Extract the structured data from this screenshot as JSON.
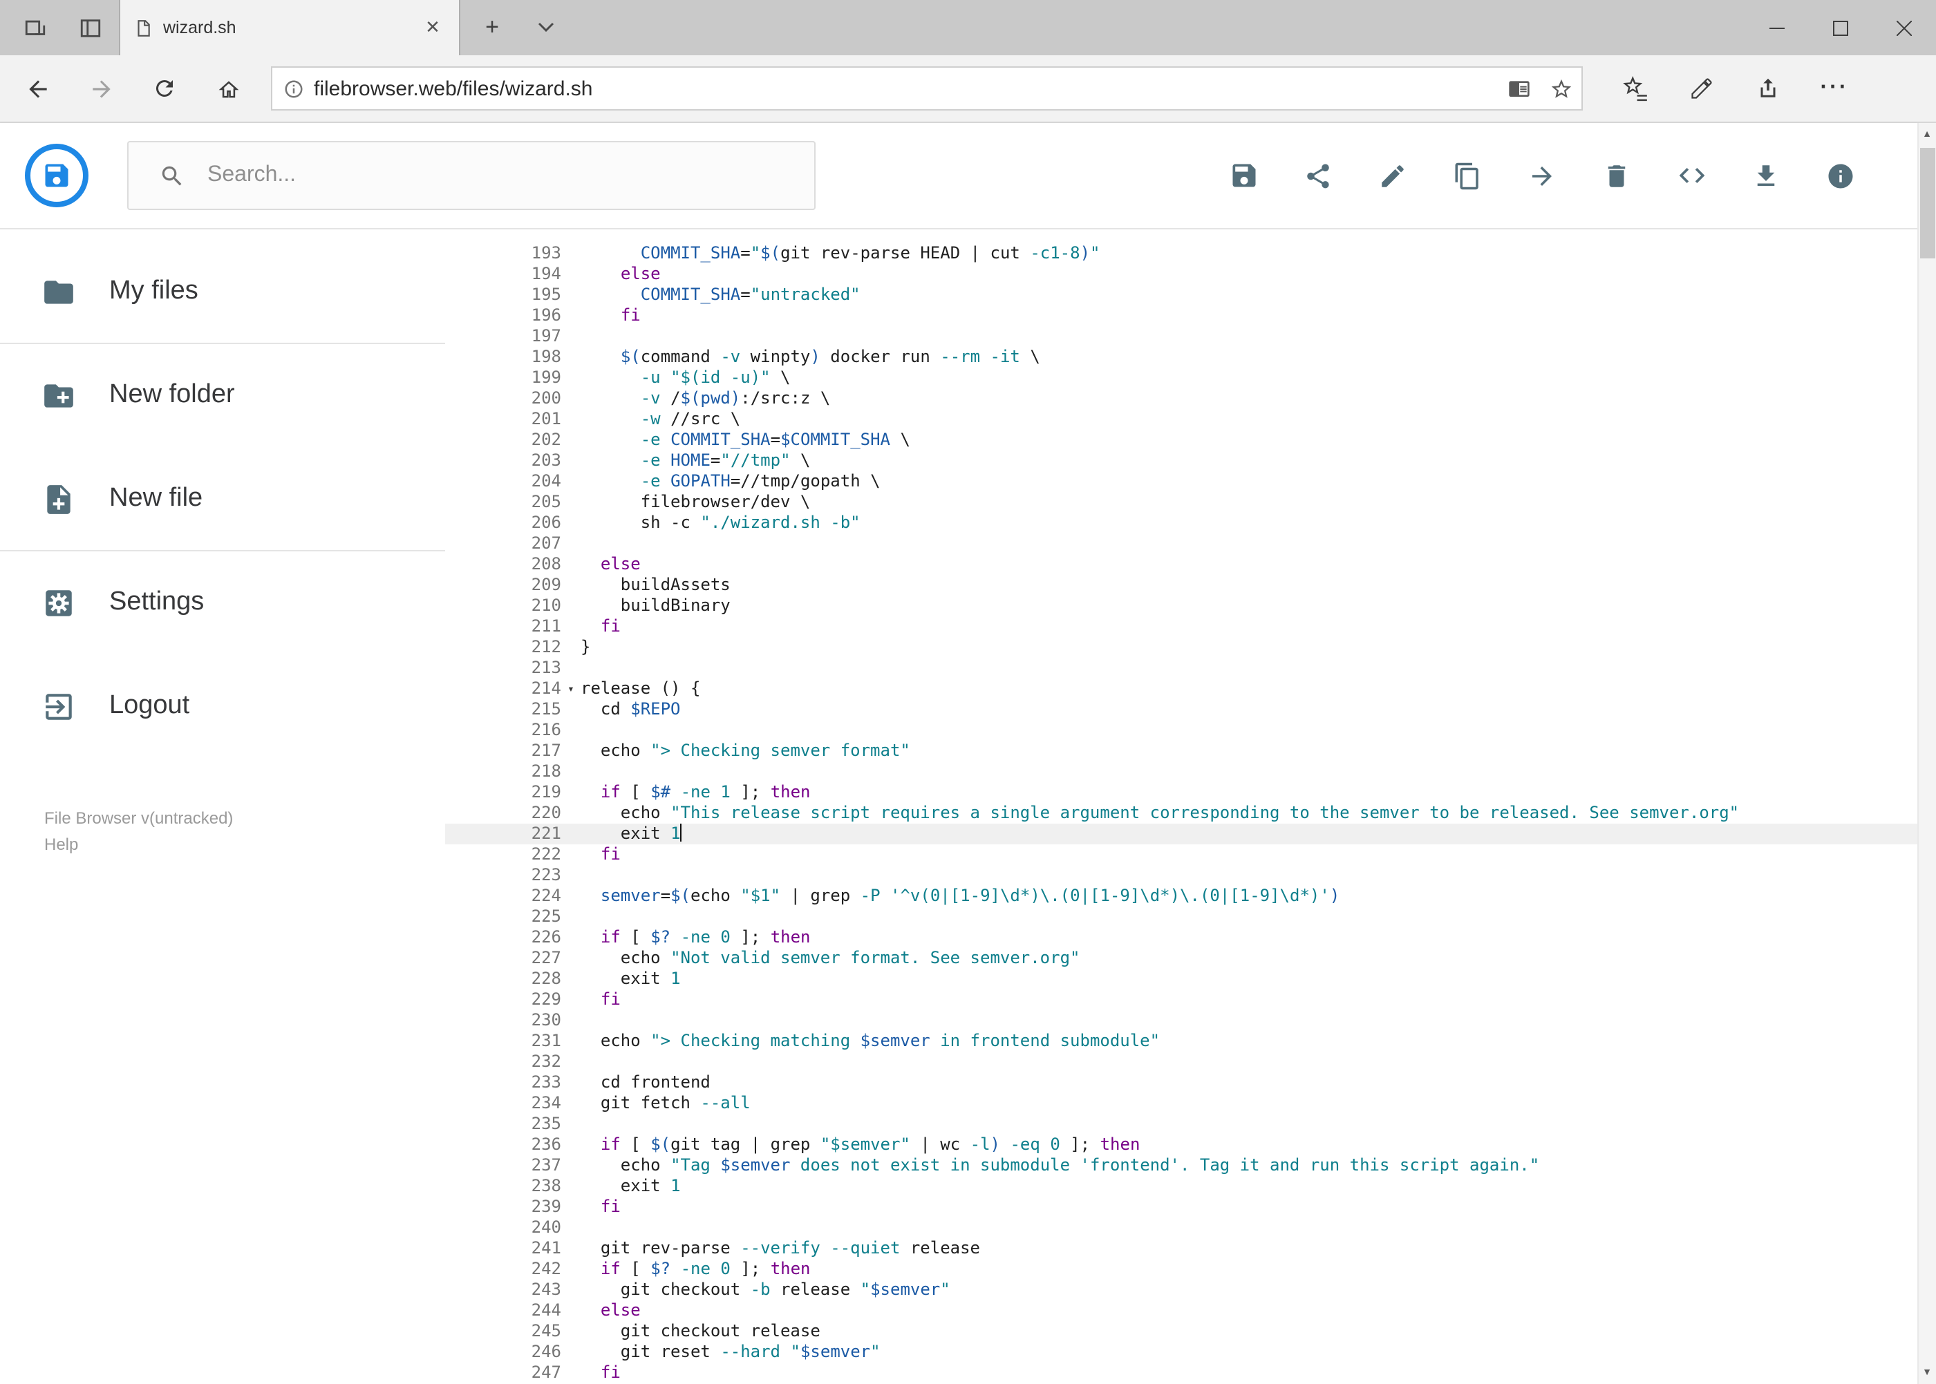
{
  "browser": {
    "tab_title": "wizard.sh",
    "url": "filebrowser.web/files/wizard.sh"
  },
  "header": {
    "search_placeholder": "Search...",
    "actions": [
      "save",
      "share",
      "edit",
      "copy",
      "move",
      "delete",
      "code",
      "download",
      "info"
    ]
  },
  "sidebar": {
    "items": [
      {
        "label": "My files",
        "icon": "folder"
      },
      {
        "label": "New folder",
        "icon": "create-new-folder"
      },
      {
        "label": "New file",
        "icon": "note-add"
      },
      {
        "label": "Settings",
        "icon": "settings"
      },
      {
        "label": "Logout",
        "icon": "logout"
      }
    ],
    "footer": {
      "version": "File Browser v(untracked)",
      "help": "Help"
    }
  },
  "colors": {
    "logo_blue": "#1e88e5",
    "header_icon": "#546e7a",
    "editor": {
      "plain": "#1f1f1f",
      "keyword": "#770088",
      "string": "#0e7f8c",
      "variable": "#1b5aa5"
    }
  },
  "editor": {
    "active_line": 221,
    "fold_lines": [
      214
    ],
    "lines": [
      {
        "n": 193,
        "t": [
          [
            "p",
            "      "
          ],
          [
            "v",
            "COMMIT_SHA"
          ],
          [
            "p",
            "="
          ],
          [
            "s",
            "\""
          ],
          [
            "v",
            "$("
          ],
          [
            "p",
            "git rev-parse HEAD | cut "
          ],
          [
            "s",
            "-c1-8"
          ],
          [
            "v",
            ")"
          ],
          [
            "s",
            "\""
          ]
        ]
      },
      {
        "n": 194,
        "t": [
          [
            "p",
            "    "
          ],
          [
            "k",
            "else"
          ]
        ]
      },
      {
        "n": 195,
        "t": [
          [
            "p",
            "      "
          ],
          [
            "v",
            "COMMIT_SHA"
          ],
          [
            "p",
            "="
          ],
          [
            "s",
            "\"untracked\""
          ]
        ]
      },
      {
        "n": 196,
        "t": [
          [
            "p",
            "    "
          ],
          [
            "k",
            "fi"
          ]
        ]
      },
      {
        "n": 197,
        "t": []
      },
      {
        "n": 198,
        "t": [
          [
            "p",
            "    "
          ],
          [
            "v",
            "$("
          ],
          [
            "p",
            "command "
          ],
          [
            "s",
            "-v"
          ],
          [
            "p",
            " winpty"
          ],
          [
            "v",
            ")"
          ],
          [
            "p",
            " docker run "
          ],
          [
            "s",
            "--rm"
          ],
          [
            "p",
            " "
          ],
          [
            "s",
            "-it"
          ],
          [
            "p",
            " \\"
          ]
        ]
      },
      {
        "n": 199,
        "t": [
          [
            "p",
            "      "
          ],
          [
            "s",
            "-u"
          ],
          [
            "p",
            " "
          ],
          [
            "s",
            "\"$(id -u)\""
          ],
          [
            "p",
            " \\"
          ]
        ]
      },
      {
        "n": 200,
        "t": [
          [
            "p",
            "      "
          ],
          [
            "s",
            "-v"
          ],
          [
            "p",
            " /"
          ],
          [
            "v",
            "$(pwd)"
          ],
          [
            "p",
            ":/src:z \\"
          ]
        ]
      },
      {
        "n": 201,
        "t": [
          [
            "p",
            "      "
          ],
          [
            "s",
            "-w"
          ],
          [
            "p",
            " //src \\"
          ]
        ]
      },
      {
        "n": 202,
        "t": [
          [
            "p",
            "      "
          ],
          [
            "s",
            "-e"
          ],
          [
            "p",
            " "
          ],
          [
            "v",
            "COMMIT_SHA"
          ],
          [
            "p",
            "="
          ],
          [
            "v",
            "$COMMIT_SHA"
          ],
          [
            "p",
            " \\"
          ]
        ]
      },
      {
        "n": 203,
        "t": [
          [
            "p",
            "      "
          ],
          [
            "s",
            "-e"
          ],
          [
            "p",
            " "
          ],
          [
            "v",
            "HOME"
          ],
          [
            "p",
            "="
          ],
          [
            "s",
            "\"//tmp\""
          ],
          [
            "p",
            " \\"
          ]
        ]
      },
      {
        "n": 204,
        "t": [
          [
            "p",
            "      "
          ],
          [
            "s",
            "-e"
          ],
          [
            "p",
            " "
          ],
          [
            "v",
            "GOPATH"
          ],
          [
            "p",
            "=//tmp/gopath \\"
          ]
        ]
      },
      {
        "n": 205,
        "t": [
          [
            "p",
            "      filebrowser/dev \\"
          ]
        ]
      },
      {
        "n": 206,
        "t": [
          [
            "p",
            "      sh -c "
          ],
          [
            "s",
            "\"./wizard.sh -b\""
          ]
        ]
      },
      {
        "n": 207,
        "t": []
      },
      {
        "n": 208,
        "t": [
          [
            "p",
            "  "
          ],
          [
            "k",
            "else"
          ]
        ]
      },
      {
        "n": 209,
        "t": [
          [
            "p",
            "    buildAssets"
          ]
        ]
      },
      {
        "n": 210,
        "t": [
          [
            "p",
            "    buildBinary"
          ]
        ]
      },
      {
        "n": 211,
        "t": [
          [
            "p",
            "  "
          ],
          [
            "k",
            "fi"
          ]
        ]
      },
      {
        "n": 212,
        "t": [
          [
            "p",
            "}"
          ]
        ]
      },
      {
        "n": 213,
        "t": []
      },
      {
        "n": 214,
        "t": [
          [
            "p",
            "release () {"
          ]
        ]
      },
      {
        "n": 215,
        "t": [
          [
            "p",
            "  cd "
          ],
          [
            "v",
            "$REPO"
          ]
        ]
      },
      {
        "n": 216,
        "t": []
      },
      {
        "n": 217,
        "t": [
          [
            "p",
            "  echo "
          ],
          [
            "s",
            "\"> Checking semver format\""
          ]
        ]
      },
      {
        "n": 218,
        "t": []
      },
      {
        "n": 219,
        "t": [
          [
            "p",
            "  "
          ],
          [
            "k",
            "if"
          ],
          [
            "p",
            " [ "
          ],
          [
            "v",
            "$#"
          ],
          [
            "p",
            " "
          ],
          [
            "s",
            "-ne"
          ],
          [
            "p",
            " "
          ],
          [
            "s",
            "1"
          ],
          [
            "p",
            " ]; "
          ],
          [
            "k",
            "then"
          ]
        ]
      },
      {
        "n": 220,
        "t": [
          [
            "p",
            "    echo "
          ],
          [
            "s",
            "\"This release script requires a single argument corresponding to the semver to be released. See semver.org\""
          ]
        ]
      },
      {
        "n": 221,
        "t": [
          [
            "p",
            "    exit "
          ],
          [
            "s",
            "1"
          ]
        ]
      },
      {
        "n": 222,
        "t": [
          [
            "p",
            "  "
          ],
          [
            "k",
            "fi"
          ]
        ]
      },
      {
        "n": 223,
        "t": []
      },
      {
        "n": 224,
        "t": [
          [
            "p",
            "  "
          ],
          [
            "v",
            "semver"
          ],
          [
            "p",
            "="
          ],
          [
            "v",
            "$("
          ],
          [
            "p",
            "echo "
          ],
          [
            "s",
            "\"$1\""
          ],
          [
            "p",
            " | grep "
          ],
          [
            "s",
            "-P"
          ],
          [
            "p",
            " "
          ],
          [
            "s",
            "'^v(0|[1-9]\\d*)\\.(0|[1-9]\\d*)\\.(0|[1-9]\\d*)'"
          ],
          [
            "v",
            ")"
          ]
        ]
      },
      {
        "n": 225,
        "t": []
      },
      {
        "n": 226,
        "t": [
          [
            "p",
            "  "
          ],
          [
            "k",
            "if"
          ],
          [
            "p",
            " [ "
          ],
          [
            "v",
            "$?"
          ],
          [
            "p",
            " "
          ],
          [
            "s",
            "-ne"
          ],
          [
            "p",
            " "
          ],
          [
            "s",
            "0"
          ],
          [
            "p",
            " ]; "
          ],
          [
            "k",
            "then"
          ]
        ]
      },
      {
        "n": 227,
        "t": [
          [
            "p",
            "    echo "
          ],
          [
            "s",
            "\"Not valid semver format. See semver.org\""
          ]
        ]
      },
      {
        "n": 228,
        "t": [
          [
            "p",
            "    exit "
          ],
          [
            "s",
            "1"
          ]
        ]
      },
      {
        "n": 229,
        "t": [
          [
            "p",
            "  "
          ],
          [
            "k",
            "fi"
          ]
        ]
      },
      {
        "n": 230,
        "t": []
      },
      {
        "n": 231,
        "t": [
          [
            "p",
            "  echo "
          ],
          [
            "s",
            "\"> Checking matching "
          ],
          [
            "v",
            "$semver"
          ],
          [
            "s",
            " in frontend submodule\""
          ]
        ]
      },
      {
        "n": 232,
        "t": []
      },
      {
        "n": 233,
        "t": [
          [
            "p",
            "  cd frontend"
          ]
        ]
      },
      {
        "n": 234,
        "t": [
          [
            "p",
            "  git fetch "
          ],
          [
            "s",
            "--all"
          ]
        ]
      },
      {
        "n": 235,
        "t": []
      },
      {
        "n": 236,
        "t": [
          [
            "p",
            "  "
          ],
          [
            "k",
            "if"
          ],
          [
            "p",
            " [ "
          ],
          [
            "v",
            "$("
          ],
          [
            "p",
            "git tag | grep "
          ],
          [
            "s",
            "\"$semver\""
          ],
          [
            "p",
            " | wc "
          ],
          [
            "s",
            "-l"
          ],
          [
            "v",
            ")"
          ],
          [
            "p",
            " "
          ],
          [
            "s",
            "-eq"
          ],
          [
            "p",
            " "
          ],
          [
            "s",
            "0"
          ],
          [
            "p",
            " ]; "
          ],
          [
            "k",
            "then"
          ]
        ]
      },
      {
        "n": 237,
        "t": [
          [
            "p",
            "    echo "
          ],
          [
            "s",
            "\"Tag "
          ],
          [
            "v",
            "$semver"
          ],
          [
            "s",
            " does not exist in submodule 'frontend'. Tag it and run this script again.\""
          ]
        ]
      },
      {
        "n": 238,
        "t": [
          [
            "p",
            "    exit "
          ],
          [
            "s",
            "1"
          ]
        ]
      },
      {
        "n": 239,
        "t": [
          [
            "p",
            "  "
          ],
          [
            "k",
            "fi"
          ]
        ]
      },
      {
        "n": 240,
        "t": []
      },
      {
        "n": 241,
        "t": [
          [
            "p",
            "  git rev-parse "
          ],
          [
            "s",
            "--verify"
          ],
          [
            "p",
            " "
          ],
          [
            "s",
            "--quiet"
          ],
          [
            "p",
            " release"
          ]
        ]
      },
      {
        "n": 242,
        "t": [
          [
            "p",
            "  "
          ],
          [
            "k",
            "if"
          ],
          [
            "p",
            " [ "
          ],
          [
            "v",
            "$?"
          ],
          [
            "p",
            " "
          ],
          [
            "s",
            "-ne"
          ],
          [
            "p",
            " "
          ],
          [
            "s",
            "0"
          ],
          [
            "p",
            " ]; "
          ],
          [
            "k",
            "then"
          ]
        ]
      },
      {
        "n": 243,
        "t": [
          [
            "p",
            "    git checkout "
          ],
          [
            "s",
            "-b"
          ],
          [
            "p",
            " release "
          ],
          [
            "s",
            "\""
          ],
          [
            "v",
            "$semver"
          ],
          [
            "s",
            "\""
          ]
        ]
      },
      {
        "n": 244,
        "t": [
          [
            "p",
            "  "
          ],
          [
            "k",
            "else"
          ]
        ]
      },
      {
        "n": 245,
        "t": [
          [
            "p",
            "    git checkout release"
          ]
        ]
      },
      {
        "n": 246,
        "t": [
          [
            "p",
            "    git reset "
          ],
          [
            "s",
            "--hard"
          ],
          [
            "p",
            " "
          ],
          [
            "s",
            "\""
          ],
          [
            "v",
            "$semver"
          ],
          [
            "s",
            "\""
          ]
        ]
      },
      {
        "n": 247,
        "t": [
          [
            "p",
            "  "
          ],
          [
            "k",
            "fi"
          ]
        ]
      }
    ]
  }
}
